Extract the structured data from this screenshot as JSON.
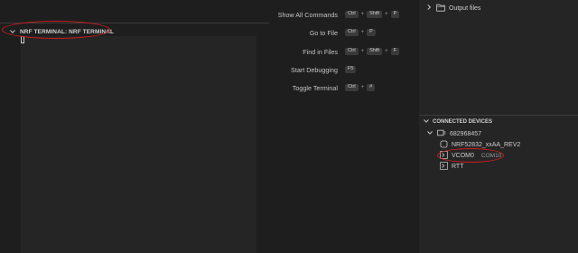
{
  "terminal": {
    "header_label": "NRF TERMINAL: NRF TERMINAL"
  },
  "commands": [
    {
      "label": "Show All Commands",
      "keys": [
        "Ctrl",
        "Shift",
        "P"
      ]
    },
    {
      "label": "Go to File",
      "keys": [
        "Ctrl",
        "P"
      ]
    },
    {
      "label": "Find in Files",
      "keys": [
        "Ctrl",
        "Shift",
        "F"
      ]
    },
    {
      "label": "Start Debugging",
      "keys": [
        "F5"
      ]
    },
    {
      "label": "Toggle Terminal",
      "keys": [
        "Ctrl",
        "#"
      ]
    }
  ],
  "explorer": {
    "output_files": "Output files"
  },
  "devices": {
    "header": "CONNECTED DEVICES",
    "serial": "682968457",
    "chip": "NRF52832_xxAA_REV2",
    "vcom": "VCOM0",
    "vcom_port": "COM10",
    "rtt": "RTT"
  },
  "colors": {
    "annotation_red": "#d21c1c",
    "panel_bg": "#252526",
    "editor_bg": "#1e1e1e"
  }
}
